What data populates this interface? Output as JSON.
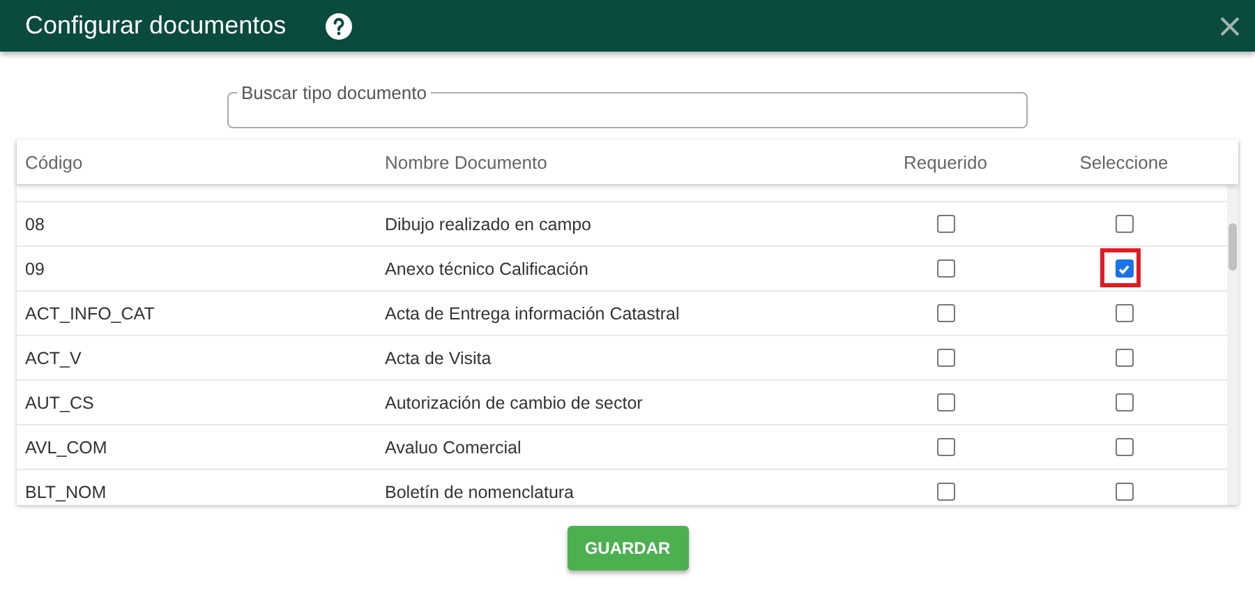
{
  "window": {
    "title": "Configurar documentos"
  },
  "search": {
    "placeholder": "Buscar tipo documento"
  },
  "table": {
    "columns": [
      "Código",
      "Nombre Documento",
      "Requerido",
      "Seleccione"
    ],
    "rows": [
      {
        "code": "08",
        "name": "Dibujo realizado en campo",
        "required": false,
        "selected": false,
        "highlighted": false
      },
      {
        "code": "09",
        "name": "Anexo técnico Calificación",
        "required": false,
        "selected": true,
        "highlighted": true
      },
      {
        "code": "ACT_INFO_CAT",
        "name": "Acta de Entrega información Catastral",
        "required": false,
        "selected": false,
        "highlighted": false
      },
      {
        "code": "ACT_V",
        "name": "Acta de Visita",
        "required": false,
        "selected": false,
        "highlighted": false
      },
      {
        "code": "AUT_CS",
        "name": "Autorización de cambio de sector",
        "required": false,
        "selected": false,
        "highlighted": false
      },
      {
        "code": "AVL_COM",
        "name": "Avaluo Comercial",
        "required": false,
        "selected": false,
        "highlighted": false
      },
      {
        "code": "BLT_NOM",
        "name": "Boletín de nomenclatura",
        "required": false,
        "selected": false,
        "highlighted": false
      }
    ]
  },
  "save_button": "GUARDAR"
}
